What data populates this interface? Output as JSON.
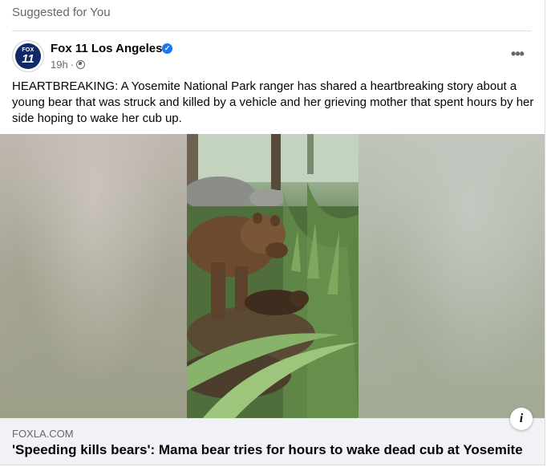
{
  "feed": {
    "section_label": "Suggested for You"
  },
  "post": {
    "page_name": "Fox 11 Los Angeles",
    "avatar": {
      "line1": "FOX",
      "line2": "11",
      "bg_color": "#0f2a66"
    },
    "verified": true,
    "verified_color": "#1877f2",
    "timestamp": "19h",
    "separator": "·",
    "audience_icon": "globe-icon",
    "more_icon": "•••",
    "text": "HEARTBREAKING: A Yosemite National Park ranger has shared a heartbreaking story about a young bear that was struck and killed by a vehicle and her grieving mother that spent hours by her side hoping to wake her cub up.",
    "image_description_icon": "i",
    "link": {
      "domain": "FOXLA.COM",
      "title": "'Speeding kills bears': Mama bear tries for hours to wake dead cub at Yosemite"
    }
  }
}
